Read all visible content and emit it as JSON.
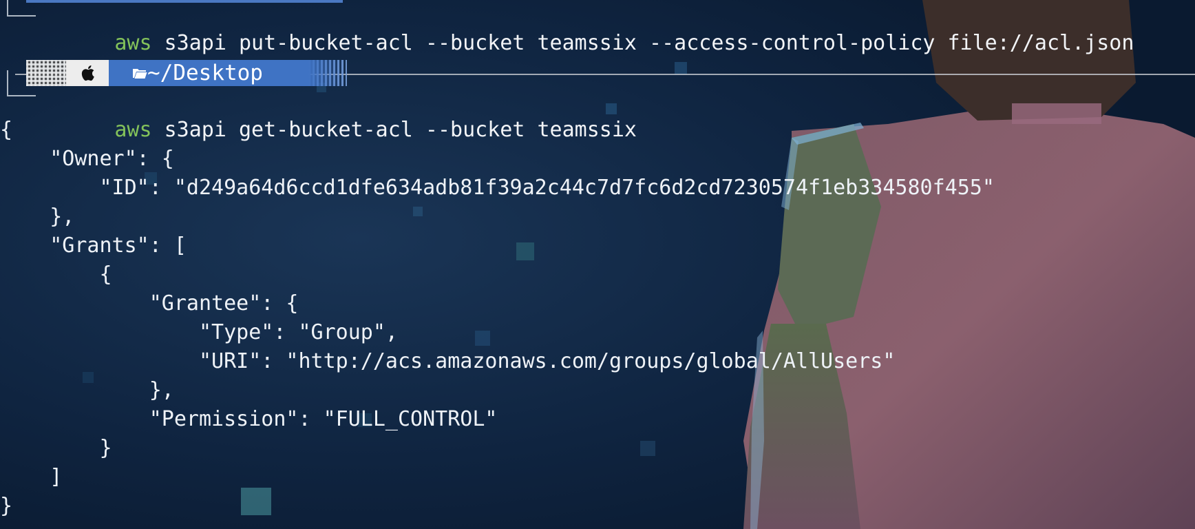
{
  "terminal": {
    "prev_command": {
      "aws": "aws",
      "rest": " s3api put-bucket-acl --bucket teamssix --access-control-policy file://acl.json"
    },
    "prompt": {
      "directory": "~/Desktop",
      "os_icon": "apple-icon",
      "folder_icon": "folder-icon"
    },
    "command": {
      "aws": "aws",
      "rest": " s3api get-bucket-acl --bucket teamssix"
    },
    "output_lines": [
      "{",
      "    \"Owner\": {",
      "        \"ID\": \"d249a64d6ccd1dfe634adb81f39a2c44c7d7fc6d2cd7230574f1eb334580f455\"",
      "    },",
      "    \"Grants\": [",
      "        {",
      "            \"Grantee\": {",
      "                \"Type\": \"Group\",",
      "                \"URI\": \"http://acs.amazonaws.com/groups/global/AllUsers\"",
      "            },",
      "            \"Permission\": \"FULL_CONTROL\"",
      "        }",
      "    ]",
      "}"
    ]
  },
  "colors": {
    "aws_command": "#83c25a",
    "text": "#eef2f7",
    "dir_segment": "#3f73c4",
    "background": "#0f2038"
  }
}
